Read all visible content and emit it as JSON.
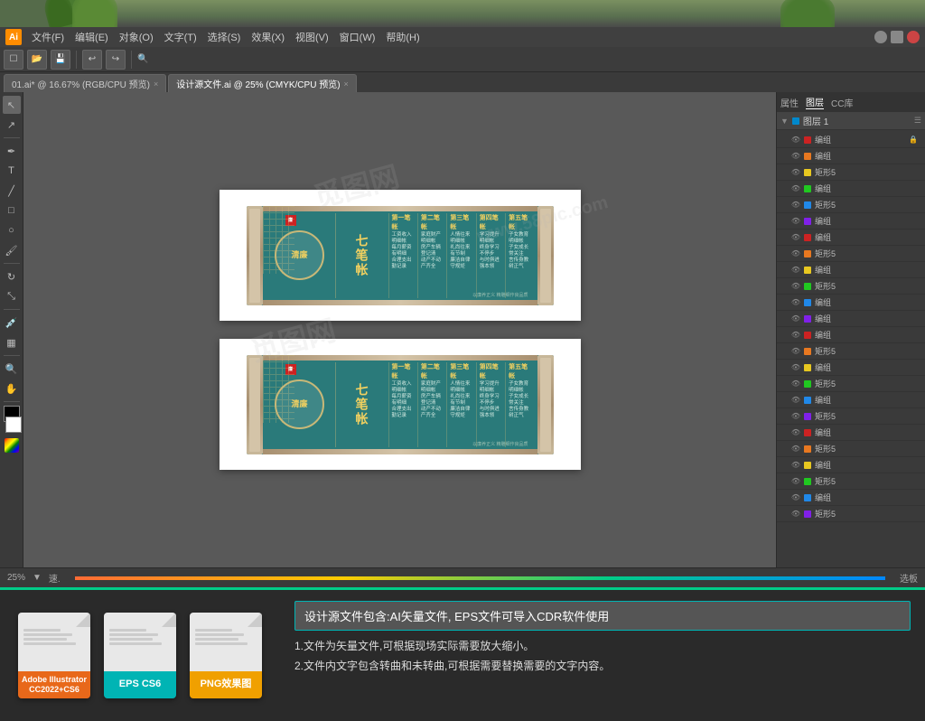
{
  "app": {
    "title": "Adobe Illustrator",
    "logo_text": "Ai"
  },
  "top_decoration": {
    "label": "decorative top area with plants"
  },
  "menu": {
    "items": [
      "文件(F)",
      "编辑(E)",
      "对象(O)",
      "文字(T)",
      "选择(S)",
      "效果(X)",
      "视图(V)",
      "窗口(W)",
      "帮助(H)"
    ]
  },
  "tabs": [
    {
      "label": "01.ai* @ 16.67% (RGB/CPU 预览)",
      "active": false
    },
    {
      "label": "设计源文件.ai @ 25% (CMYK/CPU 预览)",
      "active": true
    }
  ],
  "canvas": {
    "artboards": [
      {
        "id": 1,
        "banner": {
          "main_title": "七笔帐",
          "sub_title": "清廉",
          "badge_text": "廉",
          "bottom_text": "以廉养正义 精雕细作良品质"
        }
      },
      {
        "id": 2,
        "banner": {
          "main_title": "七笔帐",
          "sub_title": "清廉",
          "badge_text": "廉",
          "bottom_text": "以廉养正义 精雕细作良品质"
        }
      }
    ]
  },
  "layers_panel": {
    "title": "图层 1",
    "items": [
      {
        "label": "编组",
        "color": "#cc2222"
      },
      {
        "label": "编组",
        "color": "#e87820"
      },
      {
        "label": "矩形",
        "color": "#e8c820"
      },
      {
        "label": "编组",
        "color": "#20c820"
      },
      {
        "label": "矩形5",
        "color": "#2088e8"
      },
      {
        "label": "编组",
        "color": "#8020e8"
      },
      {
        "label": "编组",
        "color": "#cc2222"
      },
      {
        "label": "编组",
        "color": "#e87820"
      },
      {
        "label": "矩形",
        "color": "#e8c820"
      },
      {
        "label": "编组",
        "color": "#20c820"
      },
      {
        "label": "矩形5",
        "color": "#2088e8"
      },
      {
        "label": "编组",
        "color": "#8020e8"
      },
      {
        "label": "编组",
        "color": "#cc2222"
      },
      {
        "label": "编组",
        "color": "#e87820"
      },
      {
        "label": "矩形",
        "color": "#e8c820"
      },
      {
        "label": "编组",
        "color": "#20c820"
      },
      {
        "label": "矩形5",
        "color": "#2088e8"
      },
      {
        "label": "编组",
        "color": "#8020e8"
      },
      {
        "label": "编组",
        "color": "#cc2222"
      },
      {
        "label": "编组",
        "color": "#e87820"
      },
      {
        "label": "矩形",
        "color": "#e8c820"
      },
      {
        "label": "编组",
        "color": "#20c820"
      },
      {
        "label": "矩形5",
        "color": "#2088e8"
      },
      {
        "label": "编组",
        "color": "#8020e8"
      }
    ]
  },
  "status_bar": {
    "zoom": "25%",
    "position": "速.",
    "info": "选板"
  },
  "bottom_section": {
    "header": "设计源文件包含:AI矢量文件, EPS文件可导入CDR软件使用",
    "points": [
      "1.文件为矢量文件,可根据现场实际需要放大缩小。",
      "2.文件内文字包含转曲和未转曲,可根据需要替换需要的文字内容。"
    ],
    "file_icons": [
      {
        "label": "Adobe Illustrator\nCC2022+CS6",
        "badge_class": "badge-ai",
        "icon_char": "AI"
      },
      {
        "label": "EPS CS6",
        "badge_class": "badge-eps",
        "icon_char": "EPS"
      },
      {
        "label": "PNG效果图",
        "badge_class": "badge-png",
        "icon_char": "PNG"
      }
    ]
  },
  "watermark": {
    "text": "觅图网",
    "sub": "www.58pic.com"
  }
}
